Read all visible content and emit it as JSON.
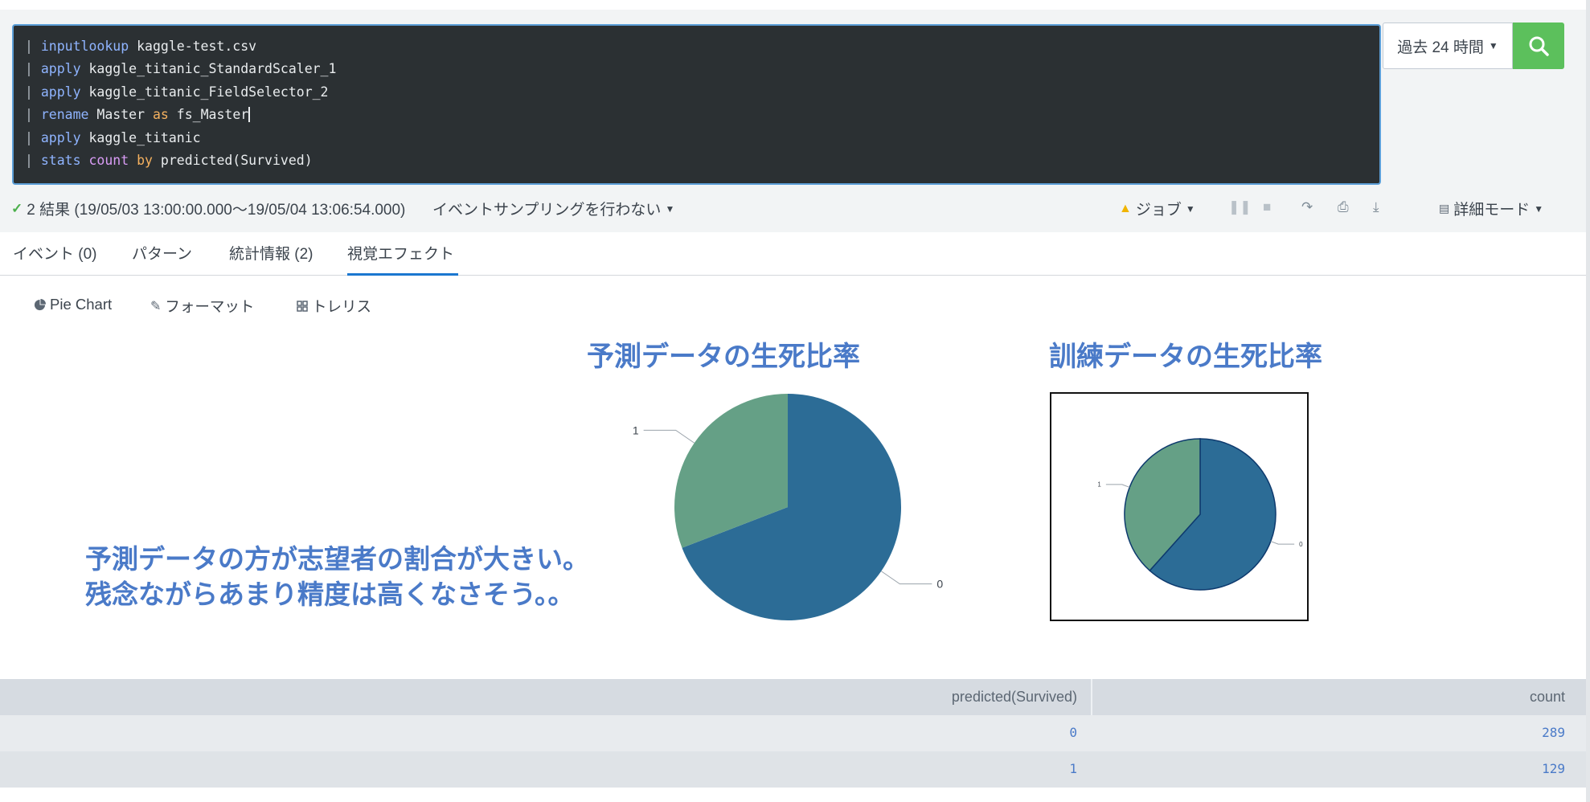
{
  "search": {
    "lines": [
      {
        "cmd": "inputlookup",
        "rest": " kaggle-test.csv"
      },
      {
        "cmd": "apply",
        "rest": " kaggle_titanic_StandardScaler_1"
      },
      {
        "cmd": "apply",
        "rest": " kaggle_titanic_FieldSelector_2"
      },
      {
        "cmd": "rename",
        "pre": " Master ",
        "op": "as",
        "post": " fs_Master"
      },
      {
        "cmd": "apply",
        "rest": " kaggle_titanic"
      },
      {
        "cmd": "stats",
        "fn": "count",
        "op": "by",
        "post": " predicted(Survived)"
      }
    ],
    "pipe": "|",
    "time_range": "過去 24 時間"
  },
  "status": {
    "results": "2 結果 (19/05/03 13:00:00.000〜19/05/04 13:06:54.000)",
    "sampling": "イベントサンプリングを行わない",
    "job": "ジョブ",
    "mode": "詳細モード"
  },
  "tabs": [
    {
      "label": "イベント (0)"
    },
    {
      "label": "パターン"
    },
    {
      "label": "統計情報 (2)"
    },
    {
      "label": "視覚エフェクト"
    }
  ],
  "viz_toolbar": {
    "chart_type": "Pie Chart",
    "format": "フォーマット",
    "trellis": "トレリス"
  },
  "headings": {
    "predicted": "予測データの生死比率",
    "training": "訓練データの生死比率"
  },
  "note": {
    "line1": "予測データの方が志望者の割合が大きい。",
    "line2": "残念ながらあまり精度は高くなさそう。。"
  },
  "colors": {
    "slice0": "#2c6c96",
    "slice1": "#65a086",
    "heading": "#4a7ac8",
    "accent": "#1a77d0",
    "search_button": "#5cc05c"
  },
  "chart_data": [
    {
      "type": "pie",
      "title": "予測データの生死比率",
      "categories": [
        "0",
        "1"
      ],
      "values": [
        289,
        129
      ]
    },
    {
      "type": "pie",
      "title": "訓練データの生死比率",
      "categories": [
        "0",
        "1"
      ],
      "values": [
        549,
        342
      ]
    }
  ],
  "table": {
    "columns": [
      "predicted(Survived)",
      "count"
    ],
    "rows": [
      [
        "0",
        "289"
      ],
      [
        "1",
        "129"
      ]
    ]
  }
}
